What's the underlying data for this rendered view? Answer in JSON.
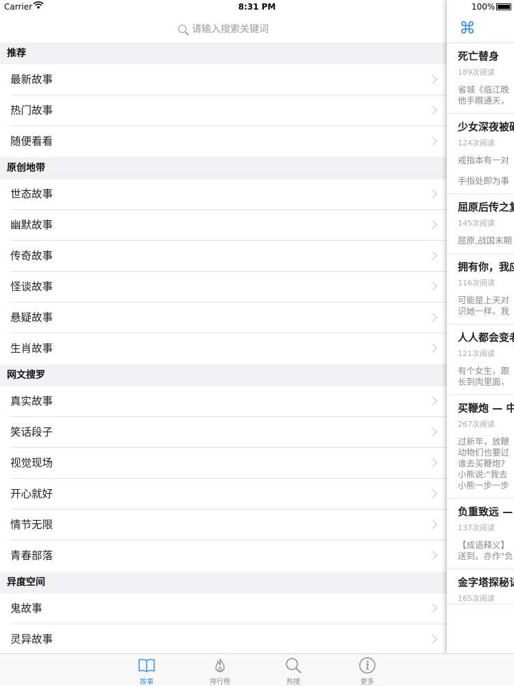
{
  "status_bar": {
    "carrier": "Carrier",
    "time": "8:31 PM",
    "battery": "100%"
  },
  "search": {
    "placeholder": "请输入搜索关键词"
  },
  "sections": [
    {
      "title": "推荐",
      "items": [
        "最新故事",
        "热门故事",
        "随便看看"
      ]
    },
    {
      "title": "原创地带",
      "items": [
        "世态故事",
        "幽默故事",
        "传奇故事",
        "怪谈故事",
        "悬疑故事",
        "生肖故事"
      ]
    },
    {
      "title": "网文搜罗",
      "items": [
        "真实故事",
        "笑话段子",
        "视觉现场",
        "开心就好",
        "情节无限",
        "青春部落"
      ]
    },
    {
      "title": "异度空间",
      "items": [
        "鬼故事",
        "灵异故事"
      ]
    }
  ],
  "stories": [
    {
      "title": "死亡替身",
      "reads": "189次阅读",
      "excerpt": [
        "省城《临江晚",
        "他手眼通天，"
      ]
    },
    {
      "title": "少女深夜被砸",
      "reads": "124次阅读",
      "excerpt": [
        "戒指本有一对",
        "",
        "手指处即为事"
      ]
    },
    {
      "title": "屈原后传之复",
      "reads": "145次阅读",
      "excerpt": [
        "屈原,战国末期"
      ]
    },
    {
      "title": "拥有你，我应",
      "reads": "116次阅读",
      "excerpt": [
        "可能是上天对",
        "识她一样。我"
      ]
    },
    {
      "title": "人人都会变老",
      "reads": "121次阅读",
      "excerpt": [
        "有个女生，跟",
        "长到肉里面，"
      ]
    },
    {
      "title": "买鞭炮 — 中",
      "reads": "267次阅读",
      "excerpt": [
        "过新年，放鞭",
        "动物们也要过",
        "谁去买鞭炮?",
        "小熊说:\"我去",
        "小熊一步一步"
      ]
    },
    {
      "title": "负重致远 —",
      "reads": "137次阅读",
      "excerpt": [
        "【成语释义】",
        "送到。亦作\"负"
      ]
    },
    {
      "title": "金字塔探秘记",
      "reads": "165次阅读",
      "excerpt": []
    }
  ],
  "tabs": [
    {
      "label": "故事",
      "icon": "book-icon",
      "active": true
    },
    {
      "label": "排行榜",
      "icon": "flame-icon",
      "active": false
    },
    {
      "label": "热搜",
      "icon": "search-icon",
      "active": false
    },
    {
      "label": "更多",
      "icon": "info-icon",
      "active": false
    }
  ],
  "colors": {
    "accent": "#3d8cf5",
    "section_bg": "#f2f2f4",
    "tab_inactive": "#8e8e93"
  }
}
